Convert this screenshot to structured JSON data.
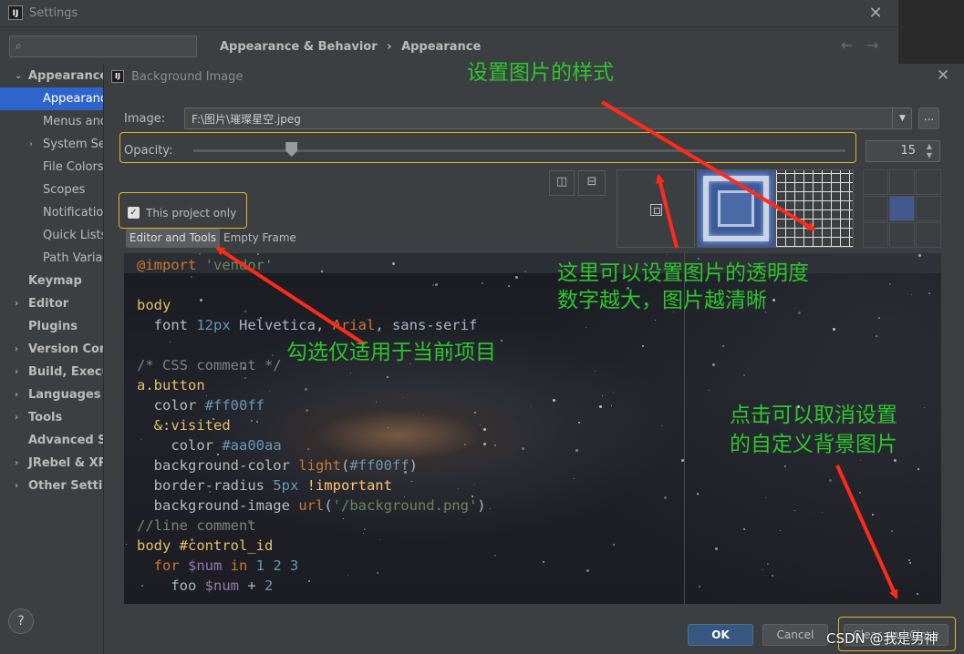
{
  "settings": {
    "app_icon": "IJ",
    "title": "Settings",
    "breadcrumb": [
      "Appearance & Behavior",
      "›",
      "Appearance"
    ],
    "search": {
      "placeholder": "",
      "icon": "search-icon"
    },
    "sidebar": [
      {
        "label": "Appearance &",
        "bold": true,
        "arrow": "⌄"
      },
      {
        "label": "Appearance",
        "selected": true
      },
      {
        "label": "Menus and"
      },
      {
        "label": "System Sett",
        "arrow": "›"
      },
      {
        "label": "File Colors"
      },
      {
        "label": "Scopes"
      },
      {
        "label": "Notification"
      },
      {
        "label": "Quick Lists"
      },
      {
        "label": "Path Variab"
      },
      {
        "label": "Keymap",
        "bold": true
      },
      {
        "label": "Editor",
        "bold": true,
        "arrow": "›"
      },
      {
        "label": "Plugins",
        "bold": true
      },
      {
        "label": "Version Contr",
        "bold": true,
        "arrow": "›"
      },
      {
        "label": "Build, Executi",
        "bold": true,
        "arrow": "›"
      },
      {
        "label": "Languages &",
        "bold": true,
        "arrow": "›"
      },
      {
        "label": "Tools",
        "bold": true,
        "arrow": "›"
      },
      {
        "label": "Advanced Set",
        "bold": true
      },
      {
        "label": "JRebel & XRe",
        "bold": true,
        "arrow": "›"
      },
      {
        "label": "Other Setting",
        "bold": true,
        "arrow": "›"
      }
    ],
    "help": "?"
  },
  "dialog": {
    "title": "Background Image",
    "image_label": "Image:",
    "image_path": "F:\\图片\\璀璨星空.jpeg",
    "browse": "...",
    "opacity_label": "Opacity:",
    "opacity_value": "15",
    "opacity_fraction": 0.15,
    "this_project_only": {
      "label": "This project only",
      "checked": true
    },
    "tabs": {
      "editor_tools": "Editor and Tools",
      "empty_frame": "Empty Frame"
    },
    "buttons": {
      "ok": "OK",
      "cancel": "Cancel",
      "clear": "Clear and Close"
    },
    "anchor_selected": "center"
  },
  "code_lines": [
    [
      [
        "c-kw",
        "@import "
      ],
      [
        "c-str",
        "'vendor'"
      ]
    ],
    [],
    [
      [
        "c-sel",
        "body"
      ]
    ],
    [
      [
        "c-prop",
        "  font "
      ],
      [
        "c-num",
        "12px"
      ],
      [
        "c-plain",
        " Helvetica, "
      ],
      [
        "c-kw",
        "Arial"
      ],
      [
        "c-plain",
        ", sans-serif"
      ]
    ],
    [],
    [
      [
        "c-com",
        "/* CSS comment */"
      ]
    ],
    [
      [
        "c-sel",
        "a.button"
      ]
    ],
    [
      [
        "c-prop",
        "  color "
      ],
      [
        "c-num",
        "#ff00ff"
      ]
    ],
    [
      [
        "c-sel",
        "  &:visited"
      ]
    ],
    [
      [
        "c-prop",
        "    color "
      ],
      [
        "c-num",
        "#aa00aa"
      ]
    ],
    [
      [
        "c-prop",
        "  background-color "
      ],
      [
        "c-kw",
        "light"
      ],
      [
        "c-plain",
        "("
      ],
      [
        "c-num",
        "#ff00ff"
      ],
      [
        "c-plain",
        ")"
      ]
    ],
    [
      [
        "c-prop",
        "  border-radius "
      ],
      [
        "c-num",
        "5px"
      ],
      [
        "c-fn",
        " !important"
      ]
    ],
    [
      [
        "c-prop",
        "  background-image "
      ],
      [
        "c-kw",
        "url"
      ],
      [
        "c-plain",
        "("
      ],
      [
        "c-str",
        "'/background.png'"
      ],
      [
        "c-plain",
        ")"
      ]
    ],
    [
      [
        "c-com",
        "//line comment"
      ]
    ],
    [
      [
        "c-sel",
        "body #control_id"
      ]
    ],
    [
      [
        "c-kw",
        "  for "
      ],
      [
        "c-var",
        "$num"
      ],
      [
        "c-kw",
        " in "
      ],
      [
        "c-num",
        "1 2 3"
      ]
    ],
    [
      [
        "c-plain",
        "    foo "
      ],
      [
        "c-var",
        "$num"
      ],
      [
        "c-plain",
        " + "
      ],
      [
        "c-num",
        "2"
      ]
    ]
  ],
  "annotations": {
    "style": "设置图片的样式",
    "opacity_1": "这里可以设置图片的透明度",
    "opacity_2": "数字越大，图片越清晰",
    "project": "勾选仅适用于当前项目",
    "clear_1": "点击可以取消设置",
    "clear_2": "的自定义背景图片"
  },
  "watermark": "CSDN @我是男神",
  "colors": {
    "accent": "#2f65ca",
    "highlight_box": "#e9b422",
    "annotation": "#2ec52e",
    "arrow": "#ff2a1a"
  }
}
